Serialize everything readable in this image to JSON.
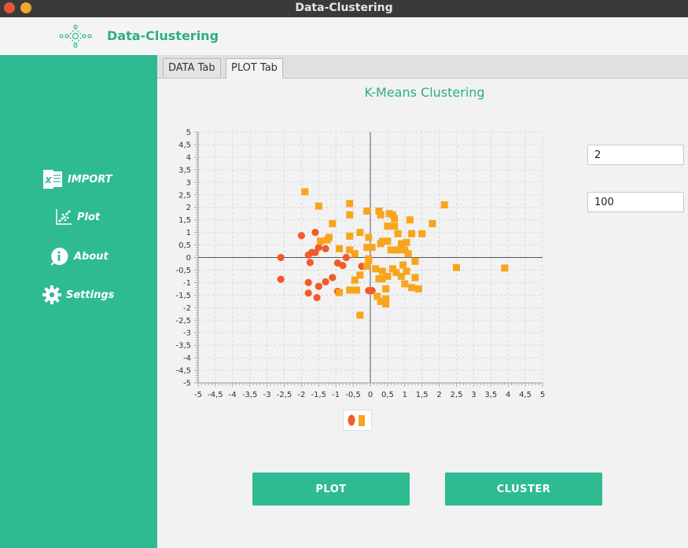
{
  "window": {
    "title": "Data-Clustering"
  },
  "header": {
    "app_name": "Data-Clustering"
  },
  "sidebar": {
    "items": [
      {
        "label": "IMPORT",
        "icon": "excel-icon"
      },
      {
        "label": "Plot",
        "icon": "scatter-plot-icon"
      },
      {
        "label": "About",
        "icon": "info-icon"
      },
      {
        "label": "Settings",
        "icon": "gear-icon"
      }
    ]
  },
  "tabs": [
    {
      "label": "DATA Tab",
      "active": false
    },
    {
      "label": "PLOT Tab",
      "active": true
    }
  ],
  "inputs": {
    "k_value": "2",
    "iterations_value": "100"
  },
  "buttons": {
    "plot": "PLOT",
    "cluster": "CLUSTER"
  },
  "colors": {
    "accent": "#2fbb92",
    "cluster_1": "#f15a2b",
    "cluster_2": "#f8a51c"
  },
  "chart_data": {
    "type": "scatter",
    "title": "K-Means Clustering",
    "xlim": [
      -5,
      5
    ],
    "ylim": [
      -5,
      5
    ],
    "x_ticks": [
      "-5",
      "-4,5",
      "-4",
      "-3,5",
      "-3",
      "-2,5",
      "-2",
      "-1,5",
      "-1",
      "-0,5",
      "0",
      "0,5",
      "1",
      "1,5",
      "2",
      "2,5",
      "3",
      "3,5",
      "4",
      "4,5",
      "5"
    ],
    "y_ticks": [
      "5",
      "4,5",
      "4",
      "3,5",
      "3",
      "2,5",
      "2",
      "1,5",
      "1",
      "0,5",
      "0",
      "-0,5",
      "-1",
      "-1,5",
      "-2",
      "-2,5",
      "-3",
      "-3,5",
      "-4",
      "-4,5",
      "-5"
    ],
    "grid": true,
    "legend": "bottom-center",
    "series": [
      {
        "marker": "circle",
        "color": "#f15a2b",
        "points": [
          [
            -2.6,
            0.0
          ],
          [
            -2.6,
            -0.87
          ],
          [
            -2.0,
            0.87
          ],
          [
            -1.6,
            1.0
          ],
          [
            -1.7,
            0.2
          ],
          [
            -1.8,
            0.1
          ],
          [
            -1.75,
            -0.2
          ],
          [
            -1.5,
            0.4
          ],
          [
            -1.6,
            0.2
          ],
          [
            -1.3,
            0.35
          ],
          [
            -1.8,
            -1.0
          ],
          [
            -1.5,
            -1.15
          ],
          [
            -1.3,
            -0.97
          ],
          [
            -1.1,
            -0.8
          ],
          [
            -1.8,
            -1.42
          ],
          [
            -1.55,
            -1.6
          ],
          [
            -0.95,
            -0.22
          ],
          [
            -0.8,
            -0.32
          ],
          [
            -0.7,
            0.0
          ],
          [
            -0.95,
            -1.35
          ],
          [
            -0.25,
            -0.35
          ],
          [
            -0.05,
            -1.32
          ],
          [
            0.05,
            -1.32
          ]
        ]
      },
      {
        "marker": "square",
        "color": "#f8a51c",
        "points": [
          [
            -1.9,
            2.62
          ],
          [
            -1.5,
            2.05
          ],
          [
            -1.1,
            1.35
          ],
          [
            -0.6,
            2.15
          ],
          [
            -0.6,
            1.7
          ],
          [
            -0.3,
            1.0
          ],
          [
            -0.1,
            1.85
          ],
          [
            -0.05,
            0.8
          ],
          [
            0.25,
            1.85
          ],
          [
            0.3,
            1.7
          ],
          [
            0.55,
            1.75
          ],
          [
            0.65,
            1.7
          ],
          [
            0.7,
            1.55
          ],
          [
            0.7,
            1.25
          ],
          [
            0.5,
            1.25
          ],
          [
            0.8,
            0.95
          ],
          [
            1.15,
            1.5
          ],
          [
            1.2,
            0.95
          ],
          [
            1.5,
            0.95
          ],
          [
            1.8,
            1.35
          ],
          [
            2.15,
            2.1
          ],
          [
            0.3,
            0.55
          ],
          [
            0.35,
            0.65
          ],
          [
            0.5,
            0.65
          ],
          [
            0.6,
            0.3
          ],
          [
            0.8,
            0.3
          ],
          [
            0.9,
            0.55
          ],
          [
            1.0,
            0.3
          ],
          [
            1.05,
            0.6
          ],
          [
            1.1,
            0.15
          ],
          [
            1.3,
            -0.15
          ],
          [
            0.95,
            -0.3
          ],
          [
            0.75,
            -0.6
          ],
          [
            0.9,
            -0.75
          ],
          [
            1.05,
            -0.55
          ],
          [
            1.3,
            -0.8
          ],
          [
            1.0,
            -1.05
          ],
          [
            1.2,
            -1.2
          ],
          [
            1.4,
            -1.25
          ],
          [
            0.65,
            -0.45
          ],
          [
            0.5,
            -0.75
          ],
          [
            0.35,
            -0.85
          ],
          [
            0.25,
            -0.85
          ],
          [
            0.15,
            -0.45
          ],
          [
            0.35,
            -0.55
          ],
          [
            0.45,
            -1.25
          ],
          [
            0.45,
            -1.65
          ],
          [
            0.45,
            -1.85
          ],
          [
            0.2,
            -1.55
          ],
          [
            0.3,
            -1.75
          ],
          [
            -0.05,
            -0.1
          ],
          [
            -0.1,
            -0.35
          ],
          [
            -0.3,
            -0.7
          ],
          [
            -0.45,
            -0.9
          ],
          [
            -0.4,
            -1.3
          ],
          [
            -0.6,
            -1.3
          ],
          [
            -0.9,
            -1.4
          ],
          [
            -0.3,
            -2.3
          ],
          [
            -0.45,
            0.15
          ],
          [
            -0.6,
            0.3
          ],
          [
            -0.6,
            0.85
          ],
          [
            -0.9,
            0.35
          ],
          [
            -1.45,
            0.65
          ],
          [
            -1.25,
            0.7
          ],
          [
            -1.2,
            0.8
          ],
          [
            -0.1,
            0.4
          ],
          [
            0.05,
            0.4
          ],
          [
            -0.05,
            -0.05
          ],
          [
            2.5,
            -0.4
          ],
          [
            3.9,
            -0.42
          ]
        ]
      }
    ]
  }
}
